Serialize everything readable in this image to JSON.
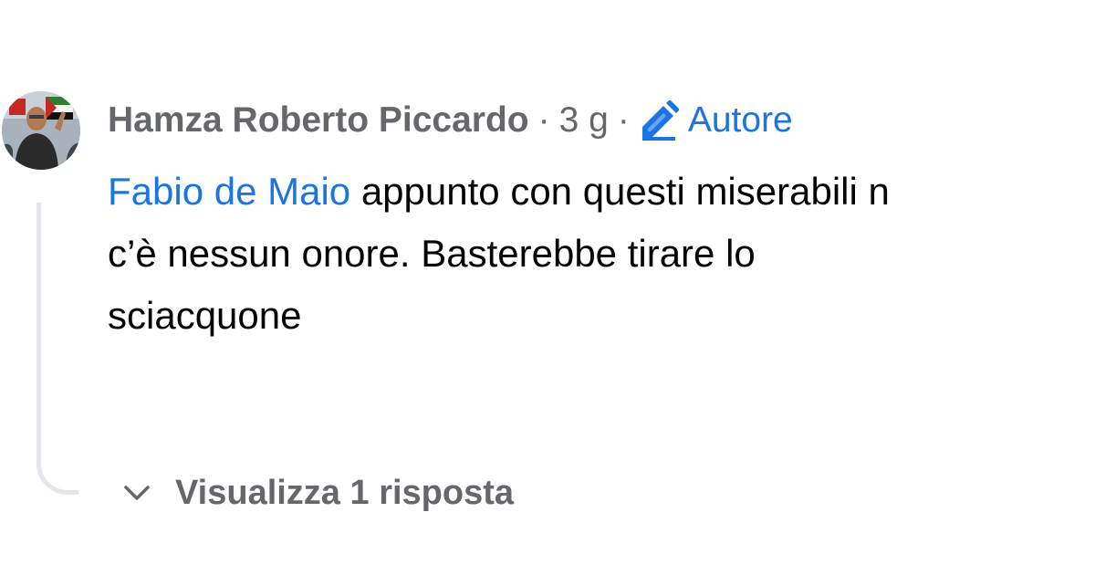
{
  "comment": {
    "author": "Hamza Roberto Piccardo",
    "separator": "·",
    "time": "3 g",
    "author_badge": "Autore",
    "mention": "Fabio de Maio",
    "text_line1": " appunto con questi miserabili n",
    "text_line2": "c’è nessun onore. Basterebbe tirare lo",
    "text_line3": "sciacquone",
    "avatar_icon": "profile-photo",
    "badge_icon": "pencil-icon"
  },
  "replies": {
    "label": "Visualizza 1 risposta",
    "icon": "chevron-down-icon"
  },
  "colors": {
    "link_blue": "#1b74e4",
    "meta_gray": "#65676b",
    "text": "#050505",
    "thread_line": "#e4e6eb"
  }
}
